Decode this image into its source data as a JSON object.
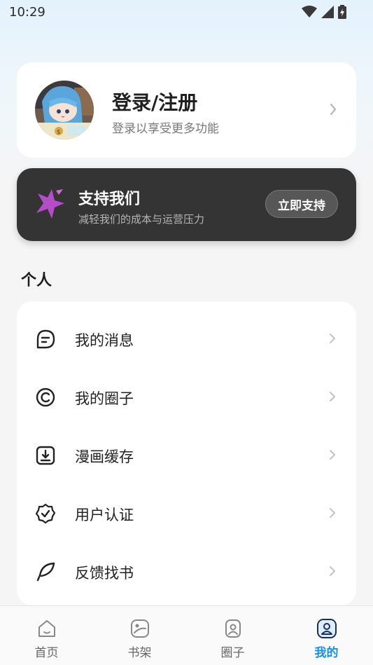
{
  "status_bar": {
    "time": "10:29"
  },
  "profile": {
    "title": "登录/注册",
    "subtitle": "登录以享受更多功能"
  },
  "support": {
    "title": "支持我们",
    "subtitle": "减轻我们的成本与运营压力",
    "button_label": "立即支持",
    "icon": "sparkle-star-icon"
  },
  "section": {
    "title": "个人"
  },
  "menu": {
    "items": [
      {
        "label": "我的消息",
        "icon": "message-icon"
      },
      {
        "label": "我的圈子",
        "icon": "circle-icon"
      },
      {
        "label": "漫画缓存",
        "icon": "download-icon"
      },
      {
        "label": "用户认证",
        "icon": "verified-badge-icon"
      },
      {
        "label": "反馈找书",
        "icon": "feather-icon"
      }
    ]
  },
  "tabbar": {
    "tabs": [
      {
        "label": "首页",
        "icon": "home-icon"
      },
      {
        "label": "书架",
        "icon": "bookshelf-icon"
      },
      {
        "label": "圈子",
        "icon": "circle-group-icon"
      },
      {
        "label": "我的",
        "icon": "profile-icon",
        "active": true
      }
    ]
  },
  "colors": {
    "accent": "#1690e0",
    "support_bg": "#343434",
    "support_star": "#b44ec8"
  }
}
